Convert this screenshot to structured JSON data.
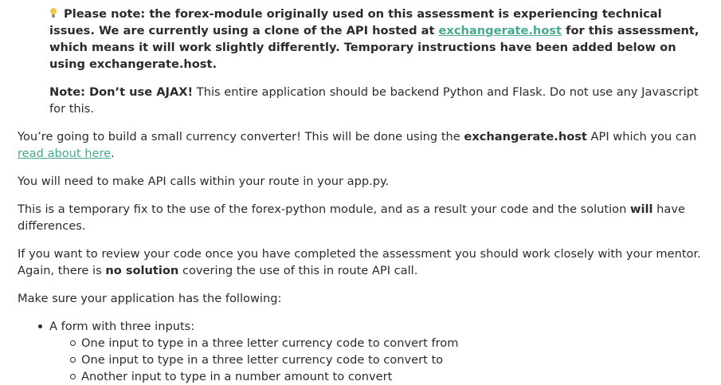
{
  "notice": {
    "icon": "lightbulb-icon",
    "text_1": "Please note: the forex-module originally used on this assessment is experiencing technical issues. We are currently using a clone of the API hosted at ",
    "link": "exchangerate.host",
    "text_2": " for this assessment, which means it will work slightly differently. Temporary instructions have been added below on using exchangerate.host."
  },
  "ajax_note": {
    "bold": "Note: Don’t use AJAX!",
    "text": " This entire application should be backend Python and Flask. Do not use any Javascript for this."
  },
  "intro": {
    "text_1": "You’re going to build a small currency converter! This will be done using the ",
    "bold": "exchangerate.host",
    "text_2": " API which you can ",
    "link": "read about here",
    "text_3": "."
  },
  "api_calls": "You will need to make API calls within your route in your app.py.",
  "temp_fix": {
    "text_1": "This is a temporary fix to the use of the forex-python module, and as a result your code and the solution ",
    "bold": "will",
    "text_2": " have differences."
  },
  "review": {
    "text_1": "If you want to review your code once you have completed the assessment you should work closely with your mentor. Again, there is ",
    "bold": "no solution",
    "text_2": " covering the use of this in route API call."
  },
  "make_sure": "Make sure your application has the following:",
  "list": {
    "item_1": "A form with three inputs:",
    "sub_items": [
      "One input to type in a three letter currency code to convert from",
      "One input to type in a three letter currency code to convert to",
      "Another input to type in a number amount to convert"
    ]
  },
  "colors": {
    "link": "#48a88f",
    "text": "#2b2b2b",
    "bulb": "#f6c84a"
  }
}
